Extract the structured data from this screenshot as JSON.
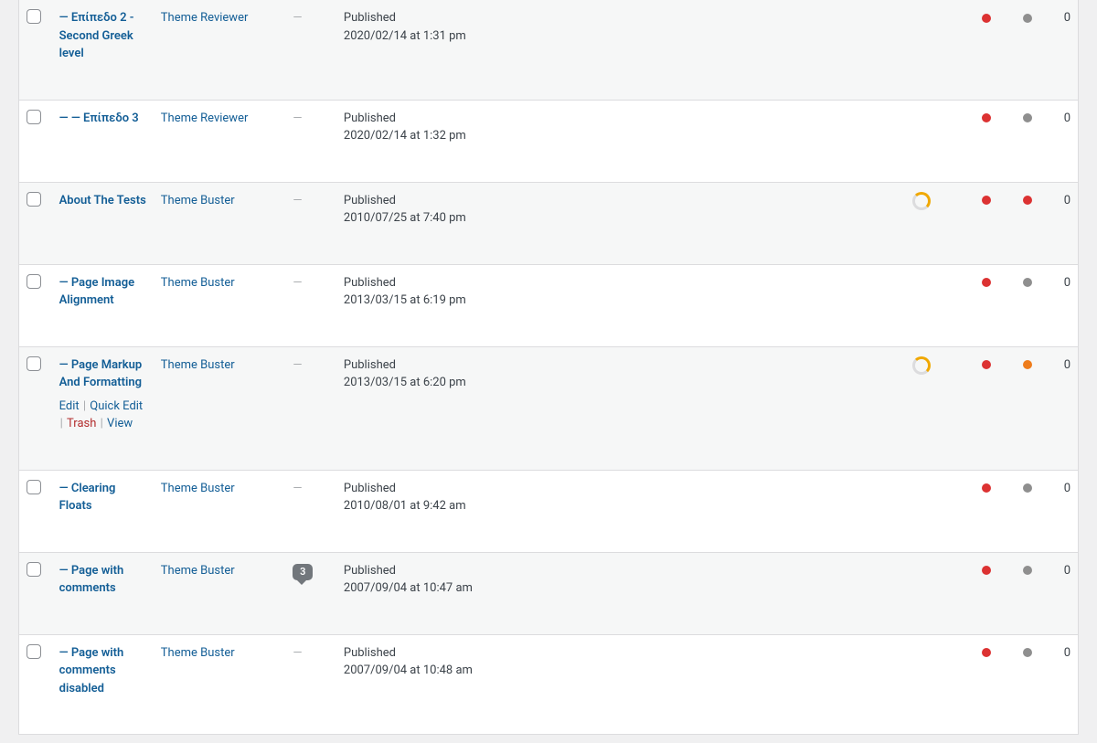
{
  "actions": {
    "edit": "Edit",
    "quick_edit": "Quick Edit",
    "trash": "Trash",
    "view": "View"
  },
  "dash": "—",
  "rows": [
    {
      "title": "— Επίπεδο 2 - Second Greek level",
      "author": "Theme Reviewer",
      "comments": null,
      "date_status": "Published",
      "date_line": "2020/02/14 at 1:31 pm",
      "seo": "red",
      "readability": "grey",
      "links": "0",
      "analysis_ring": false,
      "show_actions": false
    },
    {
      "title": "— — Επίπεδο 3",
      "author": "Theme Reviewer",
      "comments": null,
      "date_status": "Published",
      "date_line": "2020/02/14 at 1:32 pm",
      "seo": "red",
      "readability": "grey",
      "links": "0",
      "analysis_ring": false,
      "show_actions": false
    },
    {
      "title": "About The Tests",
      "author": "Theme Buster",
      "comments": null,
      "date_status": "Published",
      "date_line": "2010/07/25 at 7:40 pm",
      "seo": "red",
      "readability": "red",
      "links": "0",
      "analysis_ring": true,
      "show_actions": false
    },
    {
      "title": "— Page Image Alignment",
      "author": "Theme Buster",
      "comments": null,
      "date_status": "Published",
      "date_line": "2013/03/15 at 6:19 pm",
      "seo": "red",
      "readability": "grey",
      "links": "0",
      "analysis_ring": false,
      "show_actions": false
    },
    {
      "title": "— Page Markup And Formatting",
      "author": "Theme Buster",
      "comments": null,
      "date_status": "Published",
      "date_line": "2013/03/15 at 6:20 pm",
      "seo": "red",
      "readability": "orange",
      "links": "0",
      "analysis_ring": true,
      "show_actions": true
    },
    {
      "title": "— Clearing Floats",
      "author": "Theme Buster",
      "comments": null,
      "date_status": "Published",
      "date_line": "2010/08/01 at 9:42 am",
      "seo": "red",
      "readability": "grey",
      "links": "0",
      "analysis_ring": false,
      "show_actions": false
    },
    {
      "title": "— Page with comments",
      "author": "Theme Buster",
      "comments": "3",
      "date_status": "Published",
      "date_line": "2007/09/04 at 10:47 am",
      "seo": "red",
      "readability": "grey",
      "links": "0",
      "analysis_ring": false,
      "show_actions": false
    },
    {
      "title": "— Page with comments disabled",
      "author": "Theme Buster",
      "comments": null,
      "date_status": "Published",
      "date_line": "2007/09/04 at 10:48 am",
      "seo": "red",
      "readability": "grey",
      "links": "0",
      "analysis_ring": false,
      "show_actions": false
    }
  ]
}
